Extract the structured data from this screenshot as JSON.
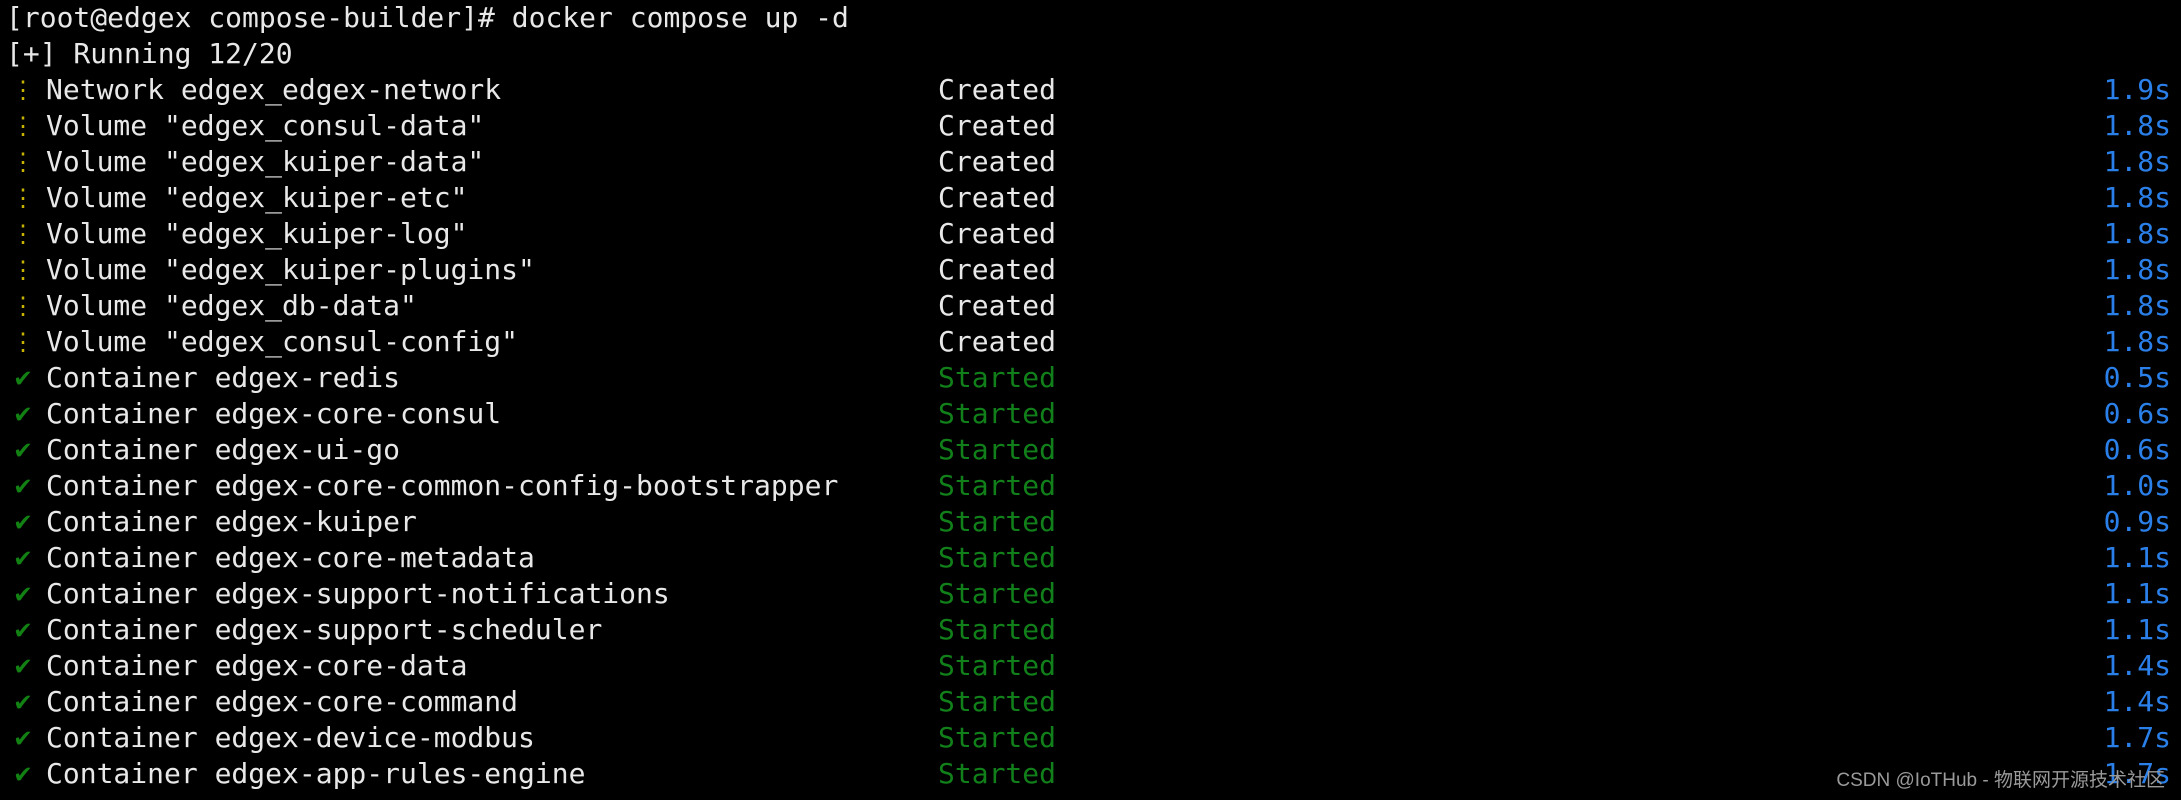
{
  "terminal": {
    "prompt_line": "[root@edgex compose-builder]# docker compose up -d",
    "summary_line": "[+] Running 12/20",
    "colors": {
      "background": "#000000",
      "foreground": "#e8e8e8",
      "pending_marker": "#c8b400",
      "done_marker": "#128012",
      "started_status": "#11801a",
      "time": "#2a7fe8",
      "watermark": "#9a9a9a"
    },
    "markers": {
      "pending_icon": "vertical-ellipsis-icon",
      "pending_glyph": "⋮",
      "done_icon": "checkmark-icon",
      "done_glyph": "✔"
    },
    "rows": [
      {
        "marker": "pending",
        "name": "Network edgex_edgex-network",
        "status": "Created",
        "time": "1.9s"
      },
      {
        "marker": "pending",
        "name": "Volume \"edgex_consul-data\"",
        "status": "Created",
        "time": "1.8s"
      },
      {
        "marker": "pending",
        "name": "Volume \"edgex_kuiper-data\"",
        "status": "Created",
        "time": "1.8s"
      },
      {
        "marker": "pending",
        "name": "Volume \"edgex_kuiper-etc\"",
        "status": "Created",
        "time": "1.8s"
      },
      {
        "marker": "pending",
        "name": "Volume \"edgex_kuiper-log\"",
        "status": "Created",
        "time": "1.8s"
      },
      {
        "marker": "pending",
        "name": "Volume \"edgex_kuiper-plugins\"",
        "status": "Created",
        "time": "1.8s"
      },
      {
        "marker": "pending",
        "name": "Volume \"edgex_db-data\"",
        "status": "Created",
        "time": "1.8s"
      },
      {
        "marker": "pending",
        "name": "Volume \"edgex_consul-config\"",
        "status": "Created",
        "time": "1.8s"
      },
      {
        "marker": "done",
        "name": "Container edgex-redis",
        "status": "Started",
        "time": "0.5s"
      },
      {
        "marker": "done",
        "name": "Container edgex-core-consul",
        "status": "Started",
        "time": "0.6s"
      },
      {
        "marker": "done",
        "name": "Container edgex-ui-go",
        "status": "Started",
        "time": "0.6s"
      },
      {
        "marker": "done",
        "name": "Container edgex-core-common-config-bootstrapper",
        "status": "Started",
        "time": "1.0s"
      },
      {
        "marker": "done",
        "name": "Container edgex-kuiper",
        "status": "Started",
        "time": "0.9s"
      },
      {
        "marker": "done",
        "name": "Container edgex-core-metadata",
        "status": "Started",
        "time": "1.1s"
      },
      {
        "marker": "done",
        "name": "Container edgex-support-notifications",
        "status": "Started",
        "time": "1.1s"
      },
      {
        "marker": "done",
        "name": "Container edgex-support-scheduler",
        "status": "Started",
        "time": "1.1s"
      },
      {
        "marker": "done",
        "name": "Container edgex-core-data",
        "status": "Started",
        "time": "1.4s"
      },
      {
        "marker": "done",
        "name": "Container edgex-core-command",
        "status": "Started",
        "time": "1.4s"
      },
      {
        "marker": "done",
        "name": "Container edgex-device-modbus",
        "status": "Started",
        "time": "1.7s"
      },
      {
        "marker": "done",
        "name": "Container edgex-app-rules-engine",
        "status": "Started",
        "time": "1.7s"
      }
    ]
  },
  "watermark": {
    "text": "CSDN @IoTHub - 物联网开源技术社区"
  }
}
